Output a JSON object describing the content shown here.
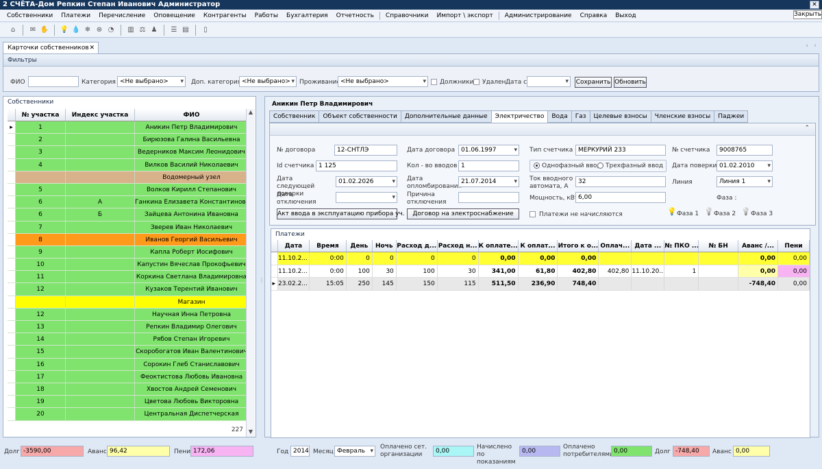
{
  "window": {
    "title": "2 СЧЁТА-Дом   Репкин Степан Иванович   Администратор",
    "close_tooltip": "Закрыть",
    "close_glyph": "✕"
  },
  "menu": [
    "Собственники",
    "Платежи",
    "Перечисление",
    "Оповещение",
    "Контрагенты",
    "Работы",
    "Бухгалтерия",
    "Отчетность",
    "Справочники",
    "Импорт \\ экспорт",
    "Администрирование",
    "Справка",
    "Выход"
  ],
  "toolbar_icons": [
    "home-icon",
    "mail-icon",
    "hand-icon",
    "bulb-icon",
    "drop-icon",
    "snowflake-icon",
    "gas-icon",
    "pie-icon",
    "chart-icon",
    "weight-icon",
    "people-icon",
    "list-icon",
    "doc-icon",
    "phone-icon"
  ],
  "doc_tab": {
    "label": "Карточки собственников",
    "close": "✕"
  },
  "filters": {
    "title": "Фильтры",
    "fio_label": "ФИО",
    "fio_value": "",
    "cat_label": "Категория",
    "cat_value": "<Не выбрано>",
    "dopcat_label": "Доп. категория",
    "dopcat_value": "<Не выбрано>",
    "prozh_label": "Проживание",
    "prozh_value": "<Не выбрано>",
    "debtors_label": "Должники",
    "deleted_label": "Удален",
    "date_from_label": "Дата с",
    "save": "Сохранить",
    "refresh": "Обновить"
  },
  "owners": {
    "title": "Собственники",
    "headers": [
      "№ участка",
      "Индекс участка",
      "ФИО"
    ],
    "rows": [
      {
        "n": "1",
        "idx": "",
        "fio": "Аникин Петр Владимирович",
        "c": "#7fe36d",
        "sel": true
      },
      {
        "n": "2",
        "idx": "",
        "fio": "Бирюзова Галина Васильевна",
        "c": "#7fe36d"
      },
      {
        "n": "3",
        "idx": "",
        "fio": "Ведерников Максим Леонидович",
        "c": "#7fe36d"
      },
      {
        "n": "4",
        "idx": "",
        "fio": "Вилков Василий Николаевич",
        "c": "#7fe36d"
      },
      {
        "n": "",
        "idx": "",
        "fio": "Водомерный узел",
        "c": "#d7b28b"
      },
      {
        "n": "5",
        "idx": "",
        "fio": "Волков Кирилл Степанович",
        "c": "#7fe36d"
      },
      {
        "n": "6",
        "idx": "А",
        "fio": "Ганкина Елизавета Константиновна",
        "c": "#7fe36d"
      },
      {
        "n": "6",
        "idx": "Б",
        "fio": "Зайцева Антонина Ивановна",
        "c": "#7fe36d"
      },
      {
        "n": "7",
        "idx": "",
        "fio": "Зверев Иван Николаевич",
        "c": "#7fe36d"
      },
      {
        "n": "8",
        "idx": "",
        "fio": "Иванов Георгий Васильевич",
        "c": "#ff9a1a"
      },
      {
        "n": "9",
        "idx": "",
        "fio": "Капла Роберт Иосифович",
        "c": "#7fe36d"
      },
      {
        "n": "10",
        "idx": "",
        "fio": "Капустин Вячеслав Прокофьевич",
        "c": "#7fe36d"
      },
      {
        "n": "11",
        "idx": "",
        "fio": "Коркина Светлана Владимировна",
        "c": "#7fe36d"
      },
      {
        "n": "12",
        "idx": "",
        "fio": "Кузаков Терентий Иванович",
        "c": "#7fe36d"
      },
      {
        "n": "",
        "idx": "",
        "fio": "Магазин",
        "c": "#ffff00"
      },
      {
        "n": "12",
        "idx": "",
        "fio": "Научная Инна Петровна",
        "c": "#7fe36d"
      },
      {
        "n": "13",
        "idx": "",
        "fio": "Репкин Владимир Олегович",
        "c": "#7fe36d"
      },
      {
        "n": "14",
        "idx": "",
        "fio": "Рябов Степан Игоревич",
        "c": "#7fe36d"
      },
      {
        "n": "15",
        "idx": "",
        "fio": "Скоробогатов Иван Валентинович",
        "c": "#7fe36d"
      },
      {
        "n": "16",
        "idx": "",
        "fio": "Сорокин Глеб Станиславович",
        "c": "#7fe36d"
      },
      {
        "n": "17",
        "idx": "",
        "fio": "Феоктистова Любовь Ивановна",
        "c": "#7fe36d"
      },
      {
        "n": "18",
        "idx": "",
        "fio": "Хвостов Андрей Семенович",
        "c": "#7fe36d"
      },
      {
        "n": "19",
        "idx": "",
        "fio": "Цветова Любовь Викторовна",
        "c": "#7fe36d"
      },
      {
        "n": "20",
        "idx": "",
        "fio": "Центральная Диспетчерская",
        "c": "#7fe36d"
      }
    ],
    "count": "227"
  },
  "left_bottom": {
    "debt_label": "Долг",
    "debt": "-3590,00",
    "avans_label": "Аванс",
    "avans": "96,42",
    "peni_label": "Пени",
    "peni": "172,06"
  },
  "card": {
    "owner": "Аникин Петр Владимирович",
    "tabs": [
      "Собственник",
      "Объект собственности",
      "Дополнительные данные",
      "Электричество",
      "Вода",
      "Газ",
      "Целевые взносы",
      "Членские взносы",
      "Паджеи"
    ],
    "active_tab": 3,
    "elec": {
      "contract_no_label": "№ договора",
      "contract_no": "12-СНТЛЭ",
      "contract_date_label": "Дата договора",
      "contract_date": "01.06.1997",
      "meter_type_label": "Тип счетчика",
      "meter_type": "МЕРКУРИЙ 233",
      "meter_no_label": "№ счетчика",
      "meter_no": "9008765",
      "meter_id_label": "Id счетчика",
      "meter_id": "1 125",
      "inputs_label": "Кол - во вводов",
      "inputs": "1",
      "single_phase": "Однофазный ввод",
      "three_phase": "Трехфазный ввод",
      "check_date_label": "Дата поверки",
      "check_date": "01.02.2010",
      "next_check_label": "Дата следующей поверки",
      "next_check": "01.02.2026",
      "seal_date_label": "Дата опломбирования",
      "seal_date": "21.07.2014",
      "current_label": "Ток вводного автомата, А",
      "current": "32",
      "line_label": "Линия",
      "line": "Линия 1",
      "off_date_label": "Дата отключения",
      "off_date": "",
      "off_reason_label": "Причина отключения",
      "off_reason": "",
      "power_label": "Мощность, кВт",
      "power": "6,00",
      "phase_label": "Фаза :",
      "act_btn": "Акт ввода в эксплуатацию прибора уч.",
      "contract_btn": "Договор на  электроснабжение",
      "no_charge_label": "Платежи не начисляются",
      "phases": [
        "Фаза 1",
        "Фаза 2",
        "Фаза 3"
      ]
    }
  },
  "payments": {
    "title": "Платежи",
    "headers": [
      "Дата",
      "Время",
      "День",
      "Ночь",
      "Расход д...",
      "Расход н...",
      "К оплате...",
      "К оплат...",
      "Итого к о...",
      "Оплач...",
      "Дата ...",
      "№ ПКО ...",
      "№ БН",
      "Аванс /...",
      "Пени"
    ],
    "rows": [
      {
        "bg": "#ffff33",
        "cells": [
          "11.10.2...",
          "0:00",
          "0",
          "0",
          "0",
          "0",
          "0,00",
          "0,00",
          "0,00",
          "",
          "",
          "",
          "",
          "0,00",
          "0,00"
        ]
      },
      {
        "bg": "#ffffff",
        "cells": [
          "11.10.2...",
          "0:00",
          "100",
          "30",
          "100",
          "30",
          "341,00",
          "61,80",
          "402,80",
          "402,80",
          "11.10.20...",
          "1",
          "",
          "0,00",
          "0,00"
        ]
      },
      {
        "bg": "#e8e8e8",
        "sel": true,
        "cells": [
          "23.02.2...",
          "15:05",
          "250",
          "145",
          "150",
          "115",
          "511,50",
          "236,90",
          "748,40",
          "",
          "",
          "",
          "",
          "-748,40",
          "0,00"
        ]
      }
    ]
  },
  "right_bottom": {
    "year_label": "Год",
    "year": "2014",
    "month_label": "Месяц",
    "month": "Февраль",
    "paid_net_label": "Оплачено сет. организации",
    "paid_net": "0,00",
    "charged_label": "Начислено по показаниям",
    "charged": "0,00",
    "paid_cons_label": "Оплачено потребителями",
    "paid_cons": "0,00",
    "debt_label": "Долг",
    "debt": "-748,40",
    "avans_label": "Аванс",
    "avans": "0,00"
  }
}
